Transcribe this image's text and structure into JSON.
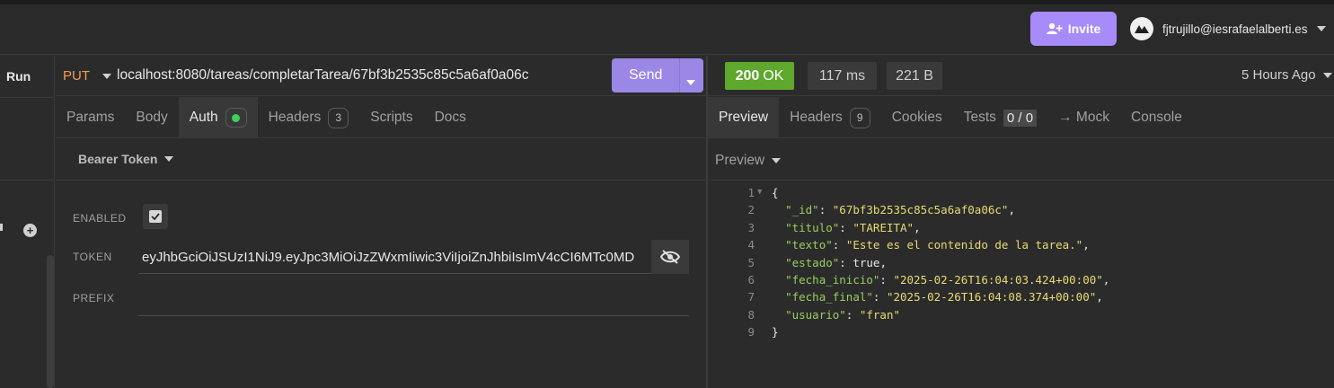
{
  "header": {
    "invite_label": "Invite",
    "user_email": "fjtrujillo@iesrafaelalberti.es"
  },
  "sidebar": {
    "run_label": "Run",
    "add_label": "+"
  },
  "request": {
    "method": "PUT",
    "url": "localhost:8080/tareas/completarTarea/67bf3b2535c85c5a6af0a06c",
    "send_label": "Send",
    "tabs": [
      {
        "label": "Params"
      },
      {
        "label": "Body"
      },
      {
        "label": "Auth"
      },
      {
        "label": "Headers",
        "badge": "3"
      },
      {
        "label": "Scripts"
      },
      {
        "label": "Docs"
      }
    ],
    "auth_type": "Bearer Token",
    "enabled_label": "ENABLED",
    "token_label": "TOKEN",
    "prefix_label": "PREFIX",
    "token_value": "eyJhbGciOiJSUzI1NiJ9.eyJpc3MiOiJzZWxmIiwic3ViIjoiZnJhbiIsImV4cCI6MTc0MD",
    "prefix_value": "",
    "enabled": true
  },
  "response": {
    "status_code": "200",
    "status_text": "OK",
    "time": "117 ms",
    "size": "221 B",
    "age": "5 Hours Ago",
    "tabs": [
      {
        "label": "Preview"
      },
      {
        "label": "Headers",
        "badge": "9"
      },
      {
        "label": "Cookies"
      },
      {
        "label": "Tests",
        "badge": "0 / 0"
      },
      {
        "label": "→ Mock"
      },
      {
        "label": "Console"
      }
    ],
    "preview_mode": "Preview",
    "body_lines": [
      {
        "n": "1",
        "text": "{"
      },
      {
        "n": "2",
        "key": "_id",
        "value": "67bf3b2535c85c5a6af0a06c",
        "type": "string"
      },
      {
        "n": "3",
        "key": "titulo",
        "value": "TAREITA",
        "type": "string"
      },
      {
        "n": "4",
        "key": "texto",
        "value": "Este es el contenido de la tarea.",
        "type": "string"
      },
      {
        "n": "5",
        "key": "estado",
        "value": "true",
        "type": "literal"
      },
      {
        "n": "6",
        "key": "fecha_inicio",
        "value": "2025-02-26T16:04:03.424+00:00",
        "type": "string"
      },
      {
        "n": "7",
        "key": "fecha_final",
        "value": "2025-02-26T16:04:08.374+00:00",
        "type": "string"
      },
      {
        "n": "8",
        "key": "usuario",
        "value": "fran",
        "type": "string",
        "last": true
      },
      {
        "n": "9",
        "text": "}"
      }
    ]
  },
  "colors": {
    "accent": "#9b87e6",
    "invite": "#a78bfa",
    "method": "#f29d49",
    "status_ok": "#5ea82e",
    "json_key": "#9acd60",
    "json_string": "#e6db74"
  }
}
